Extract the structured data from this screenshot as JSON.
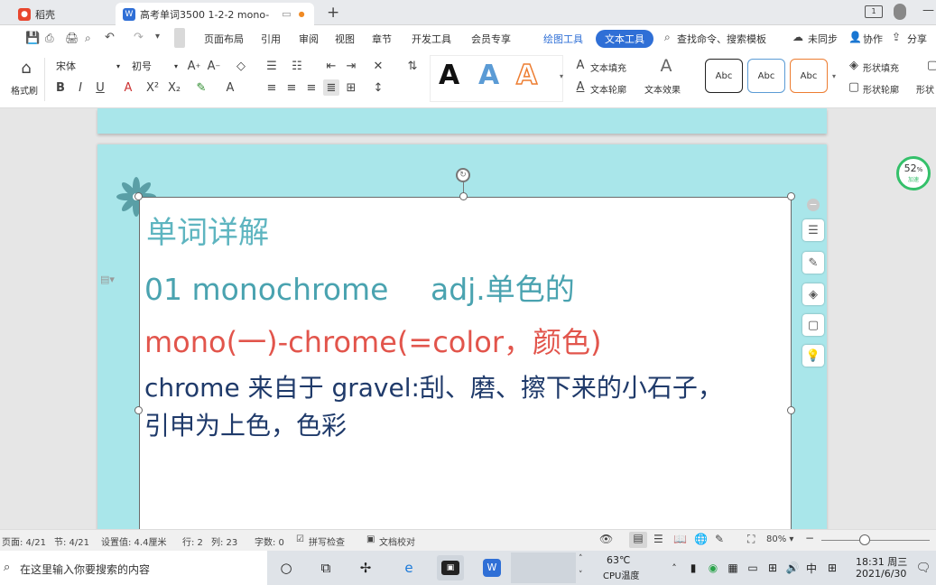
{
  "tabs": [
    {
      "label": "稻壳"
    },
    {
      "label": "高考单词3500  1-2-2 mono-"
    }
  ],
  "window": {
    "minimize": "—",
    "new_tab": "+"
  },
  "menu": {
    "items": [
      "页面布局",
      "引用",
      "审阅",
      "视图",
      "章节",
      "开发工具",
      "会员专享"
    ],
    "draw_tools": "绘图工具",
    "text_tools": "文本工具",
    "search": "查找命令、搜索模板",
    "sync": "未同步",
    "collab": "协作",
    "share": "分享"
  },
  "ribbon": {
    "format_brush": "格式刷",
    "font_name": "宋体",
    "font_size": "初号",
    "text_fill": "文本填充",
    "text_outline": "文本轮廓",
    "text_effect": "文本效果",
    "styles_letter": "A",
    "shape_styles": [
      "Abc",
      "Abc",
      "Abc"
    ],
    "shape_fill": "形状填充",
    "shape_outline": "形状轮廓",
    "shape_more": "形状"
  },
  "document": {
    "heading": "单词详解",
    "line1_word": "01 monochrome",
    "line1_def": "adj.单色的",
    "line2": "mono(一)-chrome(=color，颜色)",
    "line3": "chrome 来自于 gravel:刮、磨、擦下来的小石子，",
    "line4": "引申为上色，色彩"
  },
  "progress": {
    "percent": 52,
    "label": "52",
    "unit": "%",
    "sub": "加速"
  },
  "statusbar": {
    "page": "页面: 4/21",
    "section": "节: 4/21",
    "setting": "设置值: 4.4厘米",
    "row": "行: 2",
    "col": "列: 23",
    "words": "字数: 0",
    "spellcheck": "拼写检查",
    "proofread": "文档校对",
    "zoom": "80%"
  },
  "taskbar": {
    "search_placeholder": "在这里输入你要搜索的内容",
    "temp": "63℃",
    "temp_label": "CPU温度",
    "ime": "中",
    "time": "18:31 周三",
    "date": "2021/6/30"
  },
  "colors": {
    "page_bg": "#a9e6ea",
    "heading": "#5eb5c0",
    "line1": "#4aa3b0",
    "line2": "#e2554c",
    "line3": "#1f3a6a",
    "accent": "#2f6fd6"
  }
}
